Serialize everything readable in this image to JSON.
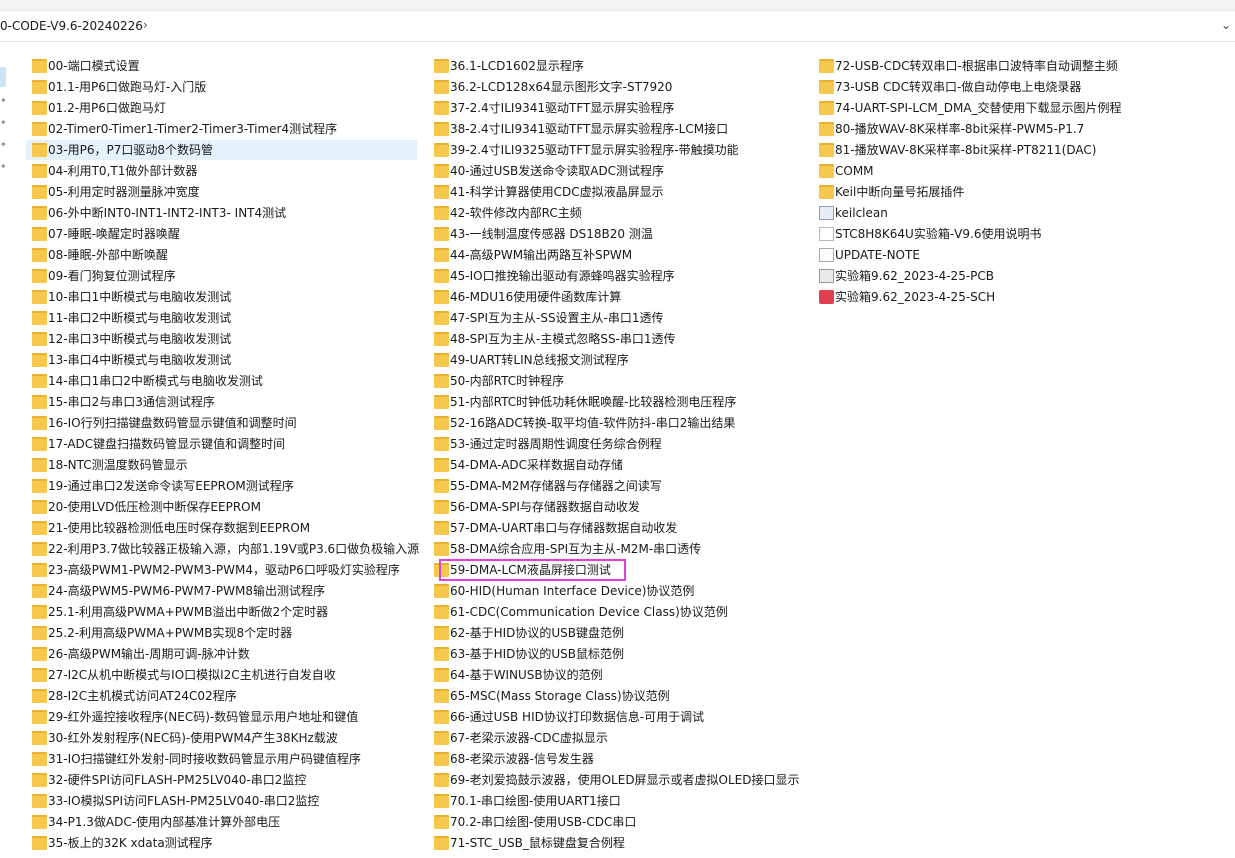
{
  "address": {
    "path": "0-CODE-V9.6-20240226",
    "separator": "›",
    "dropdown": "⌄"
  },
  "columns": [
    [
      {
        "label": "00-端口模式设置",
        "type": "folder"
      },
      {
        "label": "01.1-用P6口做跑马灯-入门版",
        "type": "folder"
      },
      {
        "label": "01.2-用P6口做跑马灯",
        "type": "folder"
      },
      {
        "label": "02-Timer0-Timer1-Timer2-Timer3-Timer4测试程序",
        "type": "folder"
      },
      {
        "label": "03-用P6，P7口驱动8个数码管",
        "type": "folder",
        "selected": true
      },
      {
        "label": "04-利用T0,T1做外部计数器",
        "type": "folder"
      },
      {
        "label": "05-利用定时器测量脉冲宽度",
        "type": "folder"
      },
      {
        "label": "06-外中断INT0-INT1-INT2-INT3- INT4测试",
        "type": "folder"
      },
      {
        "label": "07-睡眠-唤醒定时器唤醒",
        "type": "folder"
      },
      {
        "label": "08-睡眠-外部中断唤醒",
        "type": "folder"
      },
      {
        "label": "09-看门狗复位测试程序",
        "type": "folder"
      },
      {
        "label": "10-串口1中断模式与电脑收发测试",
        "type": "folder"
      },
      {
        "label": "11-串口2中断模式与电脑收发测试",
        "type": "folder"
      },
      {
        "label": "12-串口3中断模式与电脑收发测试",
        "type": "folder"
      },
      {
        "label": "13-串口4中断模式与电脑收发测试",
        "type": "folder"
      },
      {
        "label": "14-串口1串口2中断模式与电脑收发测试",
        "type": "folder"
      },
      {
        "label": "15-串口2与串口3通信测试程序",
        "type": "folder"
      },
      {
        "label": "16-IO行列扫描键盘数码管显示键值和调整时间",
        "type": "folder"
      },
      {
        "label": "17-ADC键盘扫描数码管显示键值和调整时间",
        "type": "folder"
      },
      {
        "label": "18-NTC测温度数码管显示",
        "type": "folder"
      },
      {
        "label": "19-通过串口2发送命令读写EEPROM测试程序",
        "type": "folder"
      },
      {
        "label": "20-使用LVD低压检测中断保存EEPROM",
        "type": "folder"
      },
      {
        "label": "21-使用比较器检测低电压时保存数据到EEPROM",
        "type": "folder"
      },
      {
        "label": "22-利用P3.7做比较器正极输入源，内部1.19V或P3.6口做负极输入源",
        "type": "folder"
      },
      {
        "label": "23-高级PWM1-PWM2-PWM3-PWM4，驱动P6口呼吸灯实验程序",
        "type": "folder"
      },
      {
        "label": "24-高级PWM5-PWM6-PWM7-PWM8输出测试程序",
        "type": "folder"
      },
      {
        "label": "25.1-利用高级PWMA+PWMB溢出中断做2个定时器",
        "type": "folder"
      },
      {
        "label": "25.2-利用高级PWMA+PWMB实现8个定时器",
        "type": "folder"
      },
      {
        "label": "26-高级PWM输出-周期可调-脉冲计数",
        "type": "folder"
      },
      {
        "label": "27-I2C从机中断模式与IO口模拟I2C主机进行自发自收",
        "type": "folder"
      },
      {
        "label": "28-I2C主机模式访问AT24C02程序",
        "type": "folder"
      },
      {
        "label": "29-红外遥控接收程序(NEC码)-数码管显示用户地址和键值",
        "type": "folder"
      },
      {
        "label": "30-红外发射程序(NEC码)-使用PWM4产生38KHz载波",
        "type": "folder"
      },
      {
        "label": "31-IO扫描键红外发射-同时接收数码管显示用户码键值程序",
        "type": "folder"
      },
      {
        "label": "32-硬件SPI访问FLASH-PM25LV040-串口2监控",
        "type": "folder"
      },
      {
        "label": "33-IO模拟SPI访问FLASH-PM25LV040-串口2监控",
        "type": "folder"
      },
      {
        "label": "34-P1.3做ADC-使用内部基准计算外部电压",
        "type": "folder"
      },
      {
        "label": "35-板上的32K xdata测试程序",
        "type": "folder"
      }
    ],
    [
      {
        "label": "36.1-LCD1602显示程序",
        "type": "folder"
      },
      {
        "label": "36.2-LCD128x64显示图形文字-ST7920",
        "type": "folder"
      },
      {
        "label": "37-2.4寸ILI9341驱动TFT显示屏实验程序",
        "type": "folder"
      },
      {
        "label": "38-2.4寸ILI9341驱动TFT显示屏实验程序-LCM接口",
        "type": "folder"
      },
      {
        "label": "39-2.4寸ILI9325驱动TFT显示屏实验程序-带触摸功能",
        "type": "folder"
      },
      {
        "label": "40-通过USB发送命令读取ADC测试程序",
        "type": "folder"
      },
      {
        "label": "41-科学计算器使用CDC虚拟液晶屏显示",
        "type": "folder"
      },
      {
        "label": "42-软件修改内部RC主频",
        "type": "folder"
      },
      {
        "label": "43-一线制温度传感器 DS18B20 测温",
        "type": "folder"
      },
      {
        "label": "44-高级PWM输出两路互补SPWM",
        "type": "folder"
      },
      {
        "label": "45-IO口推挽输出驱动有源蜂鸣器实验程序",
        "type": "folder"
      },
      {
        "label": "46-MDU16使用硬件函数库计算",
        "type": "folder"
      },
      {
        "label": "47-SPI互为主从-SS设置主从-串口1透传",
        "type": "folder"
      },
      {
        "label": "48-SPI互为主从-主模式忽略SS-串口1透传",
        "type": "folder"
      },
      {
        "label": "49-UART转LIN总线报文测试程序",
        "type": "folder"
      },
      {
        "label": "50-内部RTC时钟程序",
        "type": "folder"
      },
      {
        "label": "51-内部RTC时钟低功耗休眠唤醒-比较器检测电压程序",
        "type": "folder"
      },
      {
        "label": "52-16路ADC转换-取平均值-软件防抖-串口2输出结果",
        "type": "folder"
      },
      {
        "label": "53-通过定时器周期性调度任务综合例程",
        "type": "folder"
      },
      {
        "label": "54-DMA-ADC采样数据自动存储",
        "type": "folder"
      },
      {
        "label": "55-DMA-M2M存储器与存储器之间读写",
        "type": "folder"
      },
      {
        "label": "56-DMA-SPI与存储器数据自动收发",
        "type": "folder"
      },
      {
        "label": "57-DMA-UART串口与存储器数据自动收发",
        "type": "folder"
      },
      {
        "label": "58-DMA综合应用-SPI互为主从-M2M-串口透传",
        "type": "folder"
      },
      {
        "label": "59-DMA-LCM液晶屏接口测试",
        "type": "folder",
        "highlighted": true
      },
      {
        "label": "60-HID(Human Interface Device)协议范例",
        "type": "folder"
      },
      {
        "label": "61-CDC(Communication Device Class)协议范例",
        "type": "folder"
      },
      {
        "label": "62-基于HID协议的USB键盘范例",
        "type": "folder"
      },
      {
        "label": "63-基于HID协议的USB鼠标范例",
        "type": "folder"
      },
      {
        "label": "64-基于WINUSB协议的范例",
        "type": "folder"
      },
      {
        "label": "65-MSC(Mass Storage Class)协议范例",
        "type": "folder"
      },
      {
        "label": "66-通过USB HID协议打印数据信息-可用于调试",
        "type": "folder"
      },
      {
        "label": "67-老梁示波器-CDC虚拟显示",
        "type": "folder"
      },
      {
        "label": "68-老梁示波器-信号发生器",
        "type": "folder"
      },
      {
        "label": "69-老刘爱捣鼓示波器，使用OLED屏显示或者虚拟OLED接口显示",
        "type": "folder"
      },
      {
        "label": "70.1-串口绘图-使用UART1接口",
        "type": "folder"
      },
      {
        "label": "70.2-串口绘图-使用USB-CDC串口",
        "type": "folder"
      },
      {
        "label": "71-STC_USB_鼠标键盘复合例程",
        "type": "folder"
      }
    ],
    [
      {
        "label": "72-USB-CDC转双串口-根据串口波特率自动调整主频",
        "type": "folder"
      },
      {
        "label": "73-USB CDC转双串口-做自动停电上电烧录器",
        "type": "folder"
      },
      {
        "label": "74-UART-SPI-LCM_DMA_交替使用下载显示图片例程",
        "type": "folder"
      },
      {
        "label": "80-播放WAV-8K采样率-8bit采样-PWM5-P1.7",
        "type": "folder"
      },
      {
        "label": "81-播放WAV-8K采样率-8bit采样-PT8211(DAC)",
        "type": "folder"
      },
      {
        "label": "COMM",
        "type": "folder"
      },
      {
        "label": "Keil中断向量号拓展插件",
        "type": "folder"
      },
      {
        "label": "keilclean",
        "type": "exe"
      },
      {
        "label": "STC8H8K64U实验箱-V9.6使用说明书",
        "type": "file"
      },
      {
        "label": "UPDATE-NOTE",
        "type": "txt"
      },
      {
        "label": "实验箱9.62_2023-4-25-PCB",
        "type": "pcb"
      },
      {
        "label": "实验箱9.62_2023-4-25-SCH",
        "type": "sch"
      }
    ]
  ]
}
